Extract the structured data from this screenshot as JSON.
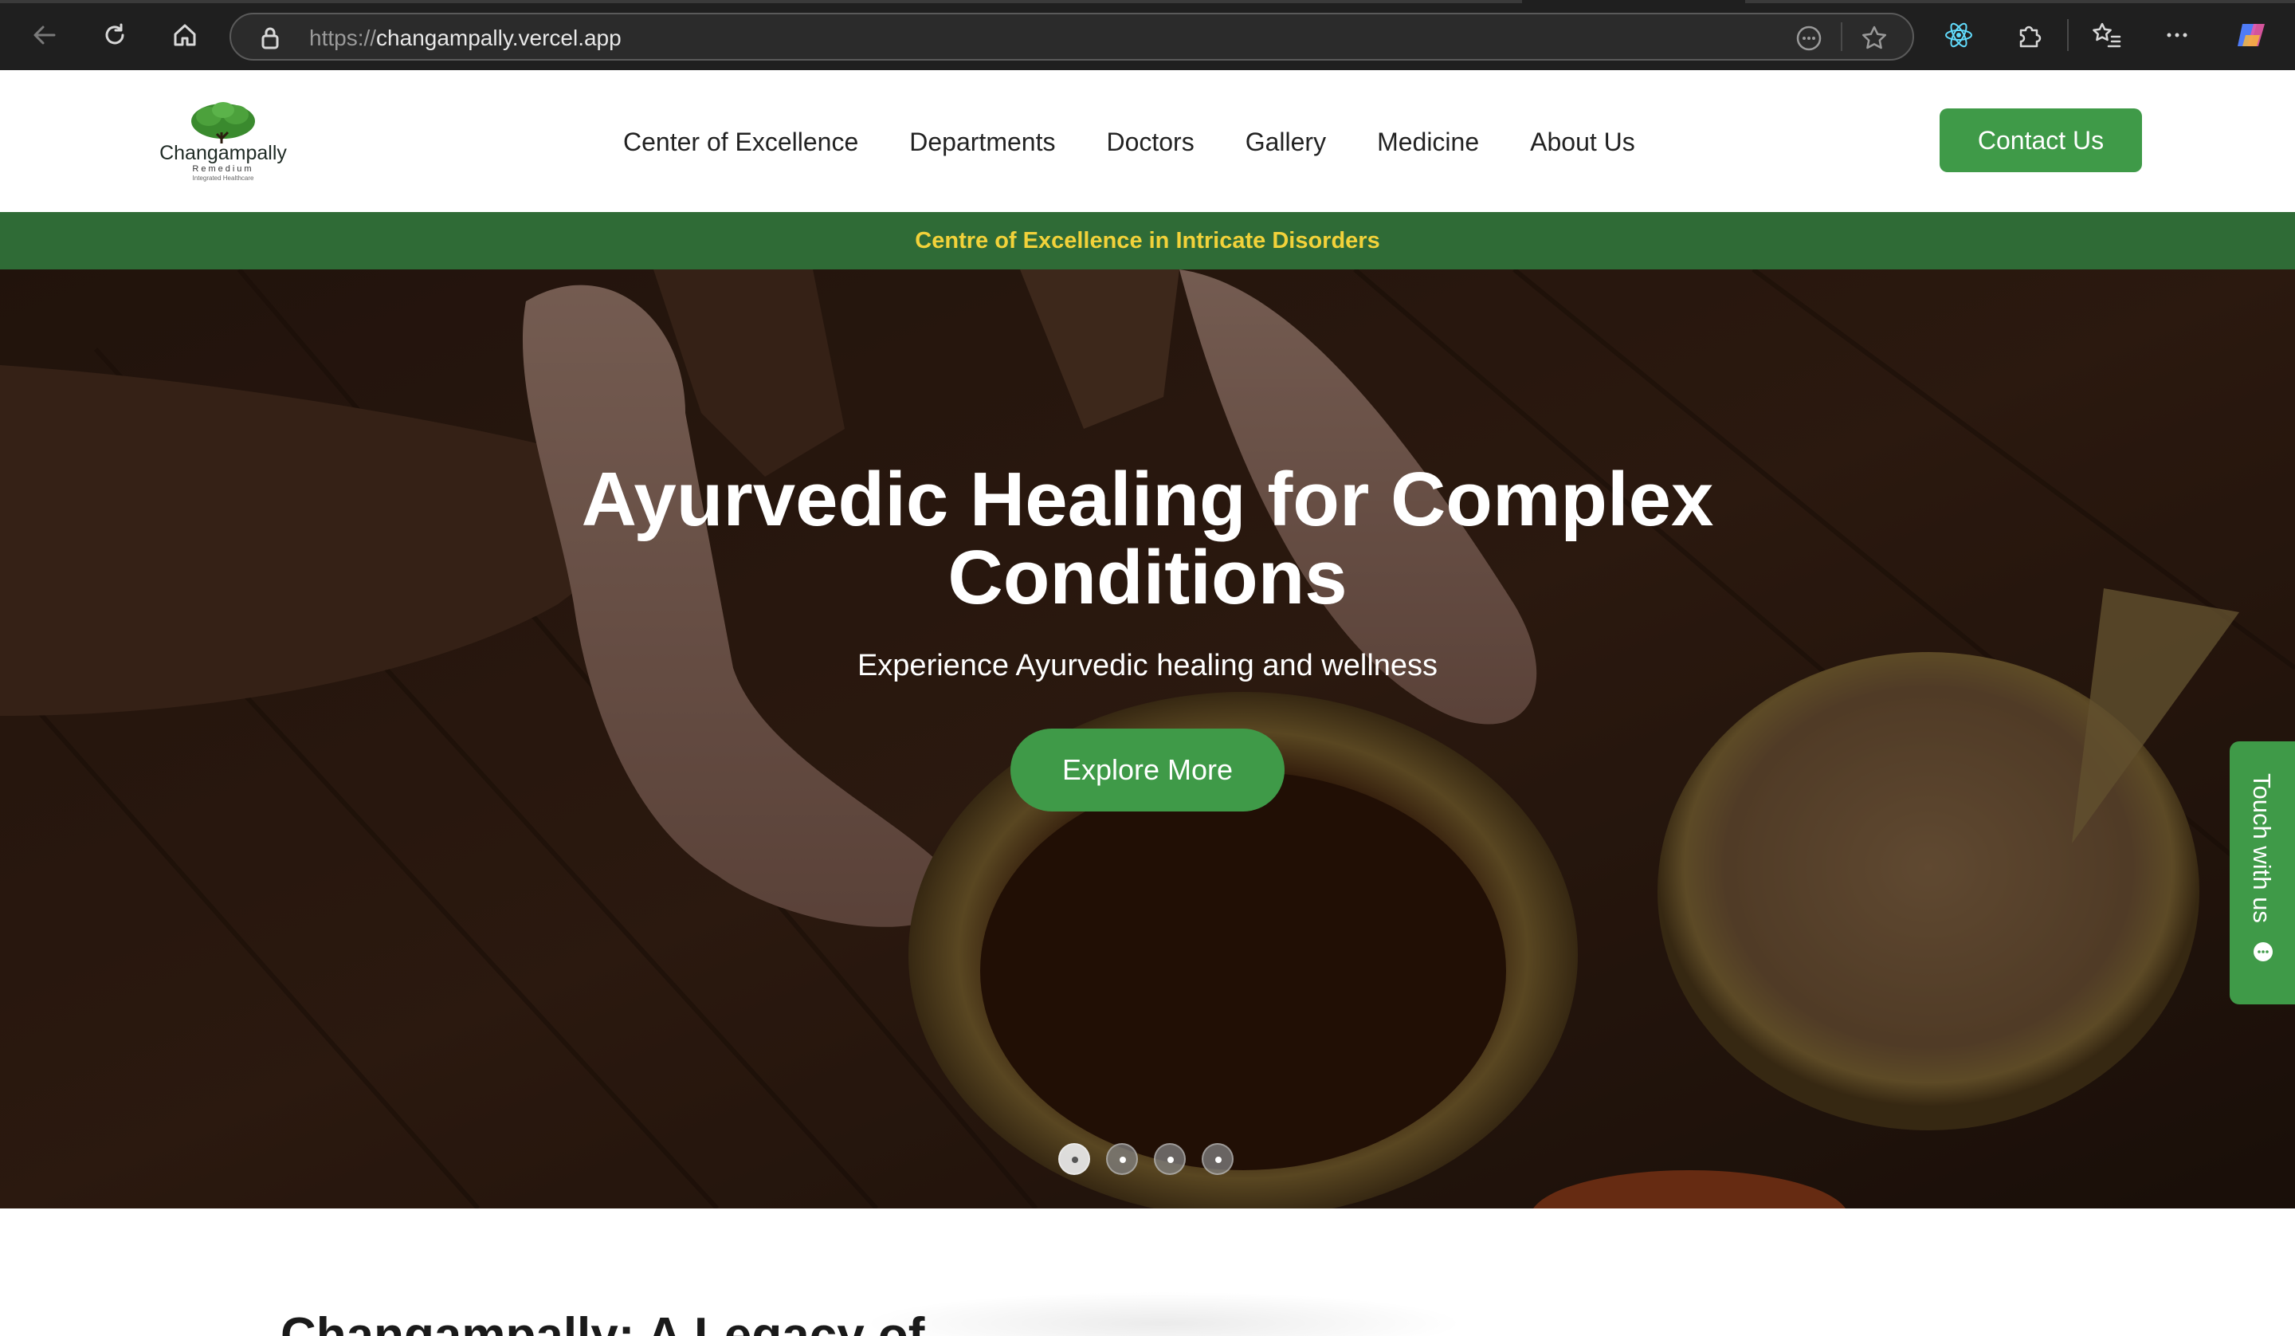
{
  "browser": {
    "url_scheme": "https://",
    "url_host": "changampally.vercel.app"
  },
  "header": {
    "logo": {
      "name": "Changampally",
      "sub": "Remedium",
      "tagline": "Integrated Healthcare"
    },
    "nav": [
      {
        "label": "Center of Excellence"
      },
      {
        "label": "Departments"
      },
      {
        "label": "Doctors"
      },
      {
        "label": "Gallery"
      },
      {
        "label": "Medicine"
      },
      {
        "label": "About Us"
      }
    ],
    "contact_label": "Contact Us"
  },
  "banner": {
    "text": "Centre of Excellence in Intricate Disorders"
  },
  "hero": {
    "title_line1": "Ayurvedic Healing for Complex",
    "title_line2": "Conditions",
    "subtitle": "Experience Ayurvedic healing and wellness",
    "cta_label": "Explore More",
    "slide_count": 4,
    "active_slide": 1
  },
  "side_tab": {
    "label": "Touch with us",
    "icon": "chat-bubble-icon"
  },
  "section": {
    "title_partial": "Changampally: A Legacy of"
  },
  "colors": {
    "primary_green": "#3f9a48",
    "banner_green": "#2f6b36",
    "banner_text": "#f2d23a",
    "chrome_bg": "#1f1f1f"
  }
}
